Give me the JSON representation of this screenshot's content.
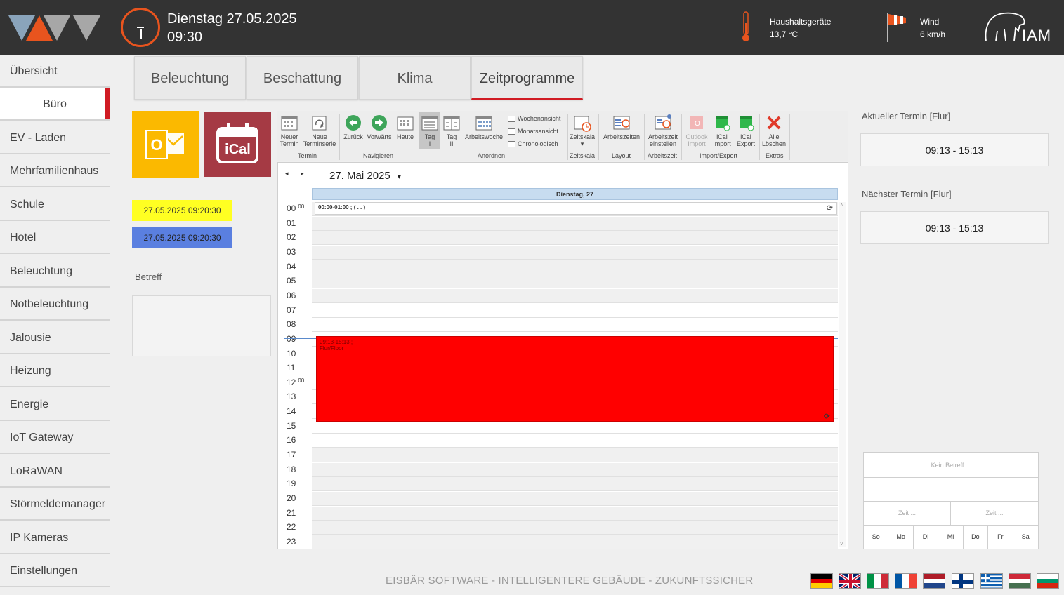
{
  "header": {
    "date": "Dienstag 27.05.2025",
    "time": "09:30",
    "sensor1_label": "Haushaltsgeräte",
    "sensor1_value": "13,7 °C",
    "sensor2_label": "Wind",
    "sensor2_value": "6 km/h",
    "logo_text": "IAM",
    "accent_color": "#e8541e"
  },
  "sidebar": {
    "items": [
      {
        "label": "Übersicht"
      },
      {
        "label": "Büro"
      },
      {
        "label": "EV - Laden"
      },
      {
        "label": "Mehrfamilienhaus"
      },
      {
        "label": "Schule"
      },
      {
        "label": "Hotel"
      },
      {
        "label": "Beleuchtung"
      },
      {
        "label": "Notbeleuchtung"
      },
      {
        "label": "Jalousie"
      },
      {
        "label": "Heizung"
      },
      {
        "label": "Energie"
      },
      {
        "label": "IoT Gateway"
      },
      {
        "label": "LoRaWAN"
      },
      {
        "label": "Störmeldemanager"
      },
      {
        "label": "IP Kameras"
      },
      {
        "label": "Einstellungen"
      }
    ],
    "active_index": 1,
    "active_color": "#d01b23"
  },
  "tabs": [
    {
      "label": "Beleuchtung"
    },
    {
      "label": "Beschattung"
    },
    {
      "label": "Klima"
    },
    {
      "label": "Zeitprogramme"
    }
  ],
  "left_panel": {
    "outlook_icon": "outlook-icon",
    "ical_label": "iCal",
    "datetime_yellow": "27.05.2025 09:20:30",
    "datetime_blue": "27.05.2025 09:20:30",
    "betreff_label": "Betreff"
  },
  "ribbon": {
    "new_appt": [
      "Neuer",
      "Termin"
    ],
    "new_series": [
      "Neue",
      "Terminserie"
    ],
    "group_termin": "Termin",
    "back": "Zurück",
    "forward": "Vorwärts",
    "today": "Heute",
    "group_nav": "Navigieren",
    "day1": [
      "Tag",
      "I"
    ],
    "day2": [
      "Tag",
      "II"
    ],
    "workweek": "Arbeitswoche",
    "week_view": "Wochenansicht",
    "month_view": "Monatsansicht",
    "chrono": "Chronologisch",
    "group_arrange": "Anordnen",
    "timescale": "Zeitskala",
    "group_timescale": "Zeitskala",
    "worktimes": "Arbeitszeiten",
    "group_layout": "Layout",
    "worktime_set": [
      "Arbeitszeit",
      "einstellen"
    ],
    "group_worktime": "Arbeitszeit",
    "outlook_import": [
      "Outlook",
      "Import"
    ],
    "ical_import": [
      "iCal",
      "Import"
    ],
    "ical_export": [
      "iCal",
      "Export"
    ],
    "group_impexp": "Import/Export",
    "delete_all": [
      "Alle",
      "Löschen"
    ],
    "group_extras": "Extras"
  },
  "calendar": {
    "title": "27. Mai 2025",
    "day_header": "Dienstag, 27",
    "hours": [
      "00",
      "01",
      "02",
      "03",
      "04",
      "05",
      "06",
      "07",
      "08",
      "09",
      "10",
      "11",
      "12",
      "13",
      "14",
      "15",
      "16",
      "17",
      "18",
      "19",
      "20",
      "21",
      "22",
      "23"
    ],
    "minute_mark": "00",
    "event_small": "00:00-01:00 ; ( . . )",
    "event_big_time": "09:13-15:13 ;",
    "event_big_text": "Flur/Floor",
    "event_color": "#ff0000"
  },
  "right_panel": {
    "current_label": "Aktueller Termin [Flur]",
    "current_value": "09:13 - 15:13",
    "next_label": "Nächster Termin [Flur]",
    "next_value": "09:13 - 15:13",
    "widget_subject": "Kein Betreff ...",
    "widget_time1": "Zeit ...",
    "widget_time2": "Zeit ...",
    "weekdays": [
      "So",
      "Mo",
      "Di",
      "Mi",
      "Do",
      "Fr",
      "Sa"
    ]
  },
  "footer": {
    "text": "EISBÄR SOFTWARE - INTELLIGENTERE GEBÄUDE - ZUKUNFTSSICHER",
    "flags": [
      "flag-de-icon",
      "flag-uk-icon",
      "flag-it-icon",
      "flag-fr-icon",
      "flag-nl-icon",
      "flag-fi-icon",
      "flag-gr-icon",
      "flag-hu-icon",
      "flag-bg-icon"
    ]
  }
}
